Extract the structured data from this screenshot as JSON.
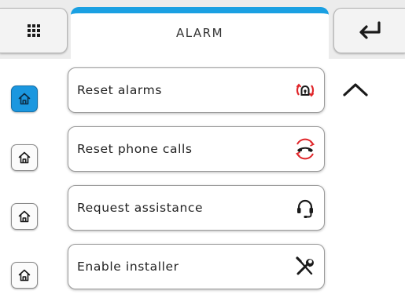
{
  "header": {
    "title": "ALARM",
    "menu_icon": "grid-menu-icon",
    "back_icon": "return-arrow-icon",
    "accent_color": "#1aa0e2"
  },
  "actions": [
    {
      "label": "Reset alarms",
      "icon": "alarm-reset-icon",
      "active": true
    },
    {
      "label": "Reset phone calls",
      "icon": "phone-reset-icon",
      "active": false
    },
    {
      "label": "Request assistance",
      "icon": "headset-icon",
      "active": false
    },
    {
      "label": "Enable installer",
      "icon": "tools-icon",
      "active": false
    }
  ],
  "home_icon": "home-icon",
  "scroll_icon": "chevron-up-icon",
  "colors": {
    "active_home": "#1b97df",
    "icon_red": "#e0262a"
  }
}
